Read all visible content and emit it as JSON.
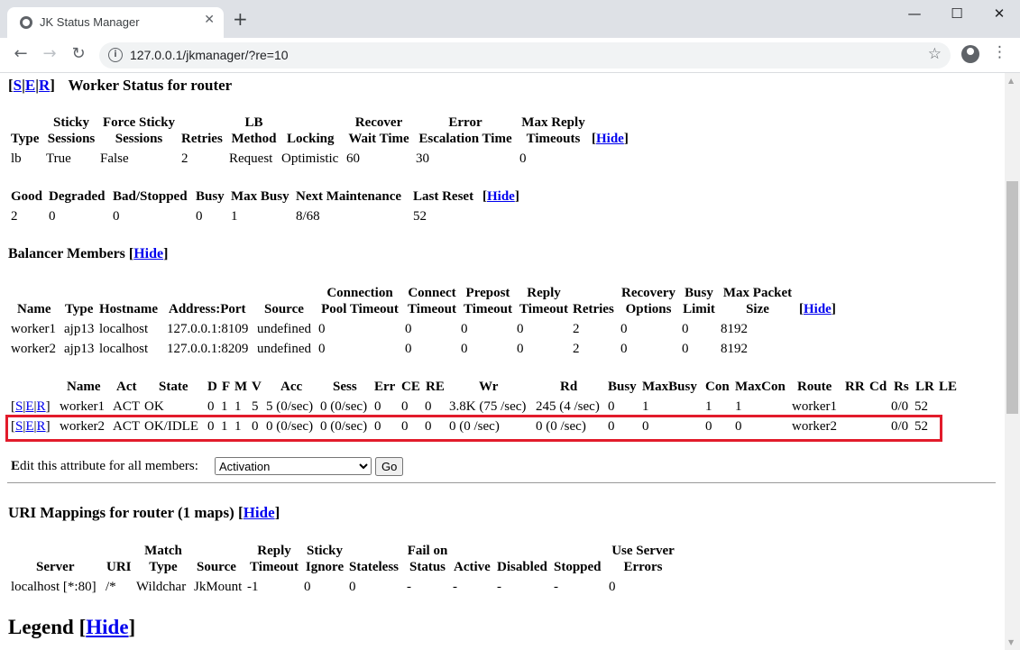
{
  "browser": {
    "tab_title": "JK Status Manager",
    "tab_close": "✕",
    "new_tab": "+",
    "minimize": "—",
    "maximize": "☐",
    "close": "✕",
    "back": "←",
    "forward": "→",
    "reload": "↻",
    "url": "127.0.0.1/jkmanager/?re=10",
    "star": "☆",
    "menu": "⋮",
    "info_icon": "i"
  },
  "worker_status": {
    "links": [
      "S",
      "E",
      "R"
    ],
    "title": "Worker Status for router",
    "headers": {
      "type": "Type",
      "sticky_sessions": [
        "Sticky",
        "Sessions"
      ],
      "force_sticky": [
        "Force Sticky",
        "Sessions"
      ],
      "retries": "Retries",
      "lb_method": [
        "LB",
        "Method"
      ],
      "locking": "Locking",
      "recover": [
        "Recover",
        "Wait Time"
      ],
      "error_escalation": [
        "Error",
        "Escalation Time"
      ],
      "max_reply": [
        "Max Reply",
        "Timeouts"
      ],
      "hide": "Hide"
    },
    "row": {
      "type": "lb",
      "sticky_sessions": "True",
      "force_sticky": "False",
      "retries": "2",
      "lb_method": "Request",
      "locking": "Optimistic",
      "recover": "60",
      "error_escalation": "30",
      "max_reply": "0"
    }
  },
  "status_summary": {
    "headers": [
      "Good",
      "Degraded",
      "Bad/Stopped",
      "Busy",
      "Max Busy",
      "Next Maintenance",
      "Last Reset"
    ],
    "hide": "Hide",
    "values": [
      "2",
      "0",
      "0",
      "0",
      "1",
      "8/68",
      "52"
    ]
  },
  "balancer_members": {
    "title": "Balancer Members",
    "hide": "Hide",
    "headers": {
      "name": "Name",
      "type": "Type",
      "hostname": "Hostname",
      "address": "Address:Port",
      "source": "Source",
      "conn_pool": [
        "Connection",
        "Pool Timeout"
      ],
      "connect_timeout": [
        "Connect",
        "Timeout"
      ],
      "prepost": [
        "Prepost",
        "Timeout"
      ],
      "reply": [
        "Reply",
        "Timeout"
      ],
      "retries": "Retries",
      "recovery": [
        "Recovery",
        "Options"
      ],
      "busy_limit": [
        "Busy",
        "Limit"
      ],
      "max_packet": [
        "Max Packet",
        "Size"
      ],
      "hide": "Hide"
    },
    "rows": [
      {
        "name": "worker1",
        "type": "ajp13",
        "hostname": "localhost",
        "address": "127.0.0.1:8109",
        "source": "undefined",
        "conn_pool": "0",
        "connect": "0",
        "prepost": "0",
        "reply": "0",
        "retries": "2",
        "recovery": "0",
        "busy_limit": "0",
        "max_packet": "8192"
      },
      {
        "name": "worker2",
        "type": "ajp13",
        "hostname": "localhost",
        "address": "127.0.0.1:8209",
        "source": "undefined",
        "conn_pool": "0",
        "connect": "0",
        "prepost": "0",
        "reply": "0",
        "retries": "2",
        "recovery": "0",
        "busy_limit": "0",
        "max_packet": "8192"
      }
    ]
  },
  "member_status": {
    "headers": [
      "Name",
      "Act",
      "State",
      "D",
      "F",
      "M",
      "V",
      "Acc",
      "Sess",
      "Err",
      "CE",
      "RE",
      "Wr",
      "Rd",
      "Busy",
      "MaxBusy",
      "Con",
      "MaxCon",
      "Route",
      "RR",
      "Cd",
      "Rs",
      "LR",
      "LE"
    ],
    "links": [
      "S",
      "E",
      "R"
    ],
    "rows": [
      {
        "name": "worker1",
        "act": "ACT",
        "state": "OK",
        "d": "0",
        "f": "1",
        "m": "1",
        "v": "5",
        "acc": "5 (0/sec)",
        "sess": "0 (0/sec)",
        "err": "0",
        "ce": "0",
        "re": "0",
        "wr": "3.8K (75 /sec)",
        "rd": "245 (4 /sec)",
        "busy": "0",
        "maxbusy": "1",
        "con": "1",
        "maxcon": "1",
        "route": "worker1",
        "rs": "0/0",
        "lr": "52"
      },
      {
        "name": "worker2",
        "act": "ACT",
        "state": "OK/IDLE",
        "d": "0",
        "f": "1",
        "m": "1",
        "v": "0",
        "acc": "0 (0/sec)",
        "sess": "0 (0/sec)",
        "err": "0",
        "ce": "0",
        "re": "0",
        "wr": "0 (0 /sec)",
        "rd": "0 (0 /sec)",
        "busy": "0",
        "maxbusy": "0",
        "con": "0",
        "maxcon": "0",
        "route": "worker2",
        "rs": "0/0",
        "lr": "52"
      }
    ]
  },
  "edit_attribute": {
    "label_first": "E",
    "label_rest": "dit this attribute for all members:",
    "selected": "Activation",
    "go": "Go"
  },
  "uri_mappings": {
    "title": "URI Mappings for router (1 maps)",
    "hide": "Hide",
    "headers": {
      "server": "Server",
      "uri": "URI",
      "match": [
        "Match",
        "Type"
      ],
      "source": "Source",
      "reply": [
        "Reply",
        "Timeout"
      ],
      "sticky": [
        "Sticky",
        "Ignore"
      ],
      "stateless": "Stateless",
      "fail": [
        "Fail on",
        "Status"
      ],
      "active": "Active",
      "disabled": "Disabled",
      "stopped": "Stopped",
      "use_server": [
        "Use Server",
        "Errors"
      ]
    },
    "row": {
      "server": "localhost [*:80]",
      "uri": "/*",
      "match": "Wildchar",
      "source": "JkMount",
      "reply": "-1",
      "sticky": "0",
      "stateless": "0",
      "fail": "-",
      "active": "-",
      "disabled": "-",
      "stopped": "-",
      "use_server": "0"
    }
  },
  "legend": {
    "title": "Legend",
    "hide": "Hide"
  }
}
